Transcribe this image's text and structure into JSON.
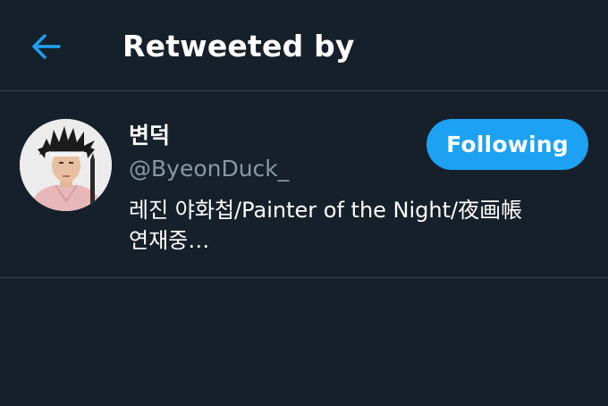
{
  "header": {
    "title": "Retweeted by",
    "back_icon": "arrow-left-icon"
  },
  "users": [
    {
      "display_name": "변덕",
      "handle": "@ByeonDuck_",
      "bio_line1": "레진 야화첩/Painter of the Night/夜画帳",
      "bio_line2": "연재중…",
      "follow_label": "Following",
      "avatar_icon": "avatar-portrait"
    }
  ],
  "colors": {
    "background": "#15202b",
    "divider": "#38444d",
    "accent": "#1da1f2",
    "secondary_text": "#8899a6"
  }
}
